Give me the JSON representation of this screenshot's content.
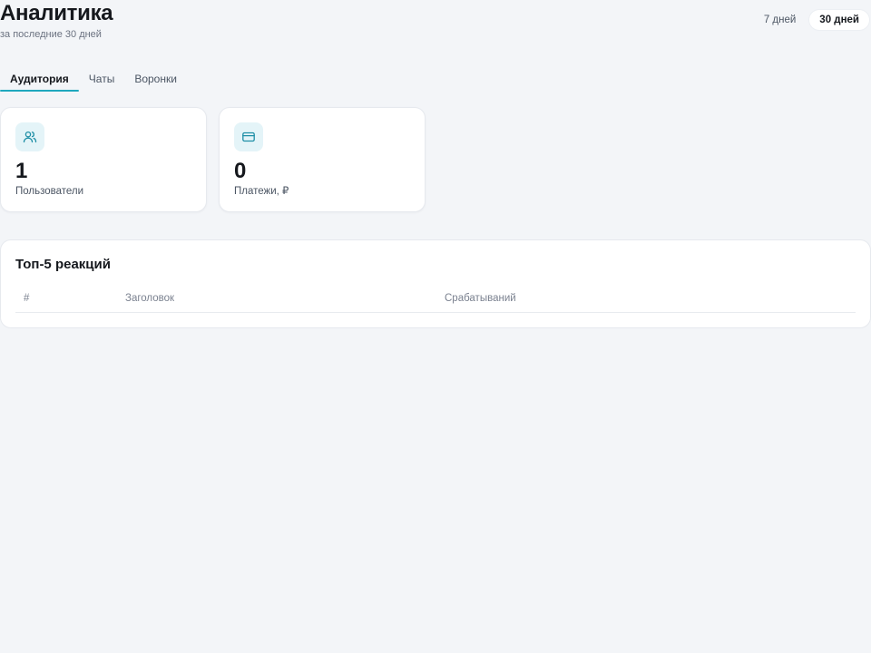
{
  "header": {
    "title": "Аналитика",
    "subtitle": "за последние 30 дней"
  },
  "period": {
    "options": [
      "7 дней",
      "30 дней"
    ],
    "selected": "30 дней"
  },
  "tabs": [
    {
      "label": "Аудитория",
      "active": true
    },
    {
      "label": "Чаты",
      "active": false
    },
    {
      "label": "Воронки",
      "active": false
    }
  ],
  "stats": [
    {
      "icon": "users-icon",
      "value": "1",
      "label": "Пользователи"
    },
    {
      "icon": "credit-card-icon",
      "value": "0",
      "label": "Платежи, ₽"
    }
  ],
  "top_reactions": {
    "title": "Топ-5 реакций",
    "columns": [
      "#",
      "Заголовок",
      "Срабатываний"
    ],
    "rows": []
  },
  "colors": {
    "accent": "#1fa8be",
    "icon_bg": "#e4f4f8",
    "background": "#f3f5f8"
  }
}
